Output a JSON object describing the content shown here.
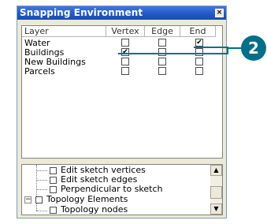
{
  "window": {
    "title": "Snapping Environment",
    "close_glyph": "×"
  },
  "layer_table": {
    "headers": {
      "layer": "Layer",
      "vertex": "Vertex",
      "edge": "Edge",
      "end": "End"
    },
    "rows": [
      {
        "label": "Water",
        "vertex": false,
        "edge": false,
        "end": true
      },
      {
        "label": "Buildings",
        "vertex": true,
        "edge": false,
        "end": false
      },
      {
        "label": "New Buildings",
        "vertex": false,
        "edge": false,
        "end": false
      },
      {
        "label": "Parcels",
        "vertex": false,
        "edge": false,
        "end": false
      }
    ]
  },
  "tree": {
    "items": [
      {
        "label": "Edit sketch vertices",
        "checked": false
      },
      {
        "label": "Edit sketch edges",
        "checked": false
      },
      {
        "label": "Perpendicular to sketch",
        "checked": false
      },
      {
        "label": "Topology Elements",
        "checked": false,
        "expander": "−"
      },
      {
        "label": "Topology nodes",
        "checked": false
      }
    ]
  },
  "scrollbar": {
    "up_glyph": "▲",
    "down_glyph": "▼"
  },
  "callout": {
    "number": "2",
    "color": "#006f8a"
  },
  "check_glyph": "✔"
}
